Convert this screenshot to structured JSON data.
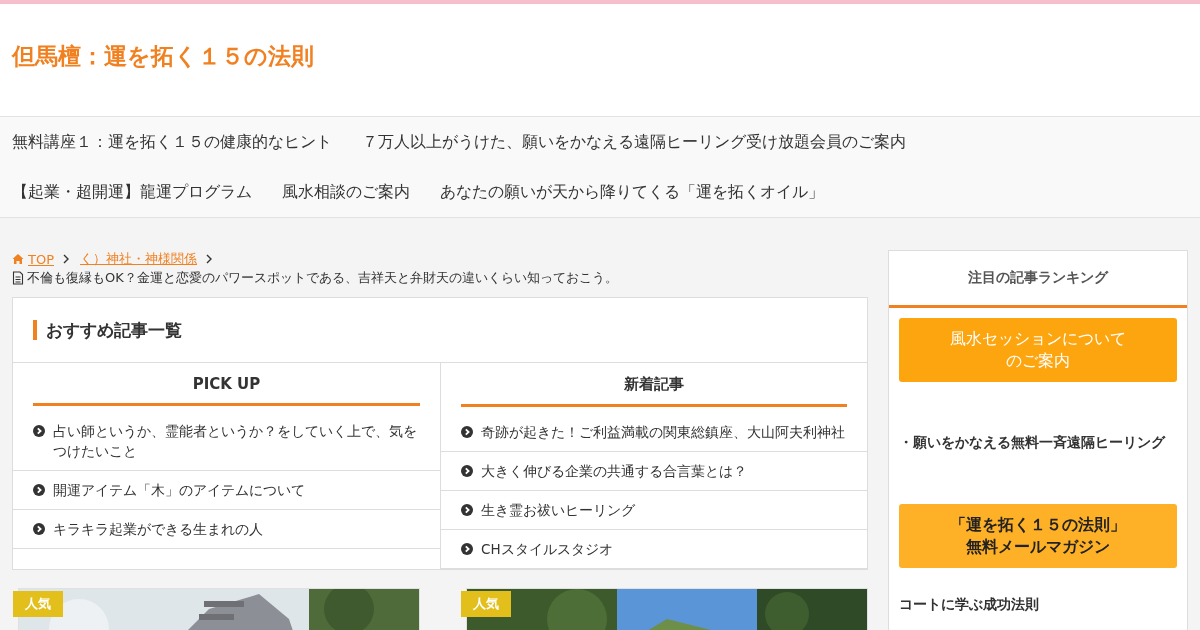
{
  "site_title": "但馬檀：運を拓く１５の法則",
  "nav": [
    {
      "label": "無料講座１：運を拓く１５の健康的なヒント"
    },
    {
      "label": "７万人以上がうけた、願いをかなえる遠隔ヒーリング受け放題会員のご案内"
    },
    {
      "label": "【起業・超開運】龍運プログラム"
    },
    {
      "label": "風水相談のご案内"
    },
    {
      "label": "あなたの願いが天から降りてくる「運を拓くオイル」"
    }
  ],
  "breadcrumb": {
    "links": [
      "TOP",
      "く）神社・神様関係"
    ],
    "current": "不倫も復縁もOK？金運と恋愛のパワースポットである、吉祥天と弁財天の違いくらい知っておこう。"
  },
  "recommend": {
    "title": "おすすめ記事一覧",
    "columns": [
      {
        "heading": "PICK UP",
        "items": [
          "占い師というか、霊能者というか？をしていく上で、気をつけたいこと",
          "開運アイテム「木」のアイテムについて",
          "キラキラ起業ができる生まれの人"
        ]
      },
      {
        "heading": "新着記事",
        "items": [
          "奇跡が起きた！ご利益満載の関東総鎮座、大山阿夫利神社",
          "大きく伸びる企業の共通する合言葉とは？",
          "生き霊お祓いヒーリング",
          "CHスタイルスタジオ"
        ]
      }
    ]
  },
  "cards": [
    {
      "badge": "人気",
      "kind": "picture"
    },
    {
      "badge": "人気",
      "kind": "picture"
    }
  ],
  "sidebar": {
    "tab": "注目の記事ランキング",
    "blocks": [
      {
        "kind": "button",
        "lines": [
          "風水セッションについて",
          "のご案内"
        ]
      },
      {
        "kind": "text",
        "text": "・願いをかなえる無料一斉遠隔ヒーリング"
      },
      {
        "kind": "button-dark",
        "lines": [
          "「運を拓く１５の法則」",
          "無料メールマガジン"
        ]
      },
      {
        "kind": "heading",
        "text": "コートに学ぶ成功法則"
      }
    ]
  }
}
